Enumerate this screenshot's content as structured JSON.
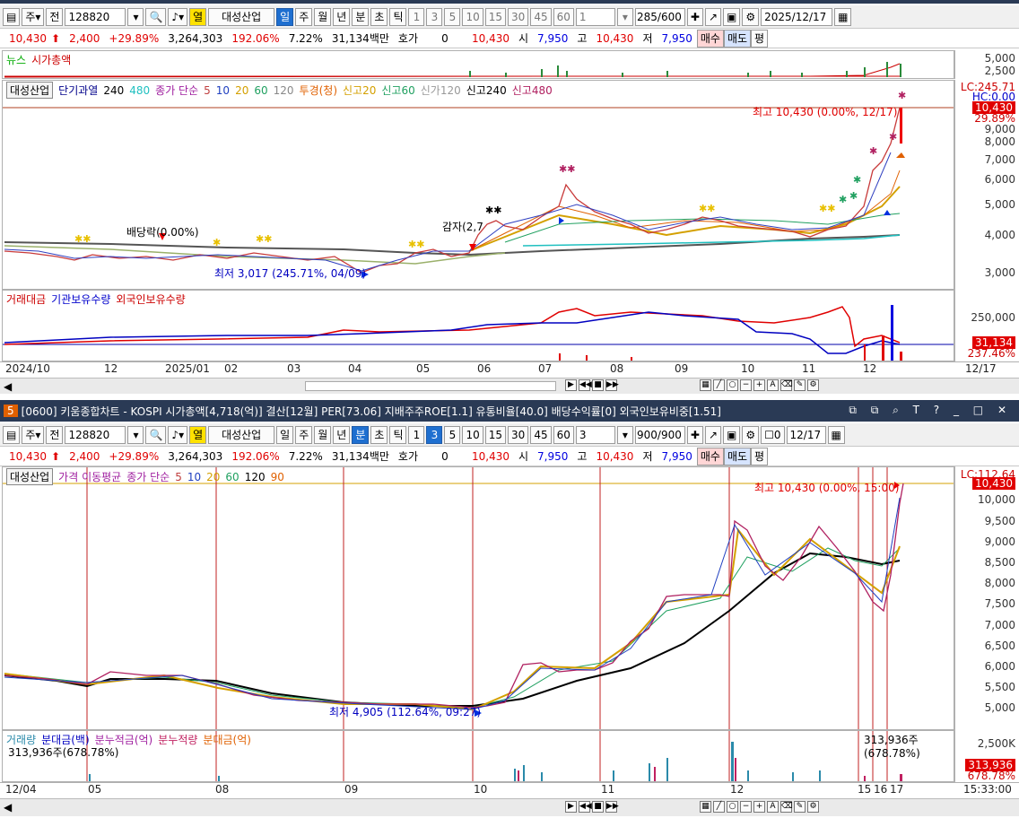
{
  "top": {
    "toolbar": {
      "mode1": "주",
      "prev": "전",
      "code": "128820",
      "hot": "열",
      "name": "대성산업",
      "periods": [
        "일",
        "주",
        "월",
        "년",
        "분",
        "초",
        "틱"
      ],
      "nums": [
        "1",
        "3",
        "5",
        "10",
        "15",
        "30",
        "45",
        "60"
      ],
      "unit": "1",
      "count": "285/600",
      "date": "2025/12/17"
    },
    "quote": {
      "price": "10,430",
      "change": "2,400",
      "rate": "+29.89%",
      "volume": "3,264,303",
      "vol_ratio": "192.06%",
      "turnover": "7.22%",
      "amount": "31,134백만",
      "ask_label": "호가",
      "ask": "0",
      "ask_price": "10,430",
      "open_label": "시",
      "open": "7,950",
      "high_label": "고",
      "high": "10,430",
      "low_label": "저",
      "low": "7,950",
      "buy": "매수",
      "sell": "매도",
      "eval": "평"
    },
    "news_legend": [
      "뉴스",
      "시가총액"
    ],
    "news_axis": [
      "5,000",
      "2,500"
    ],
    "price_legend": {
      "name": "대성산업",
      "ma_label": "단기과열",
      "n240": "240",
      "n480": "480",
      "close_label": "종가 단순",
      "p5": "5",
      "p10": "10",
      "p20": "20",
      "p60": "60",
      "p120": "120",
      "invest": "투경(청)",
      "hi20": "신고20",
      "hi60": "신고60",
      "lo120": "신가120",
      "hi240": "신고240",
      "hi480": "신고480"
    },
    "price_axis": [
      "9,000",
      "8,000",
      "7,000",
      "6,000",
      "5,000",
      "4,000",
      "3,000"
    ],
    "lc": "LC:245.71",
    "hc": "HC:0.00",
    "price_tag": "10,430",
    "price_tag2": "29.89%",
    "hi_note": "최고 10,430 (0.00%, 12/17)",
    "lo_note": "최저 3,017 (245.71%, 04/09)",
    "div_note": "배당락(0.00%)",
    "cap_note": "감자(2,7",
    "vol_legend": [
      "거래대금",
      "기관보유수량",
      "외국인보유수량"
    ],
    "vol_axis": [
      "250,000"
    ],
    "vol_tag": "31,134",
    "vol_tag2": "237.46%",
    "xaxis": [
      "2024/10",
      "12",
      "2025/01",
      "02",
      "03",
      "04",
      "05",
      "06",
      "07",
      "08",
      "09",
      "10",
      "11",
      "12",
      "12/17"
    ]
  },
  "bottom": {
    "title": "[0600] 키움종합차트 - KOSPI 시가총액[4,718(억)] 결산[12월] PER[73.06] 지배주주ROE[1.1] 유통비율[40.0] 배당수익률[0] 외국인보유비중[1.51]",
    "badge": "5",
    "toolbar": {
      "mode1": "주",
      "prev": "전",
      "code": "128820",
      "hot": "열",
      "name": "대성산업",
      "periods": [
        "일",
        "주",
        "월",
        "년",
        "분",
        "초",
        "틱"
      ],
      "nums": [
        "1",
        "3",
        "5",
        "10",
        "15",
        "30",
        "45",
        "60"
      ],
      "unit": "3",
      "count": "900/900",
      "flag": "0",
      "date": "12/17"
    },
    "quote": {
      "price": "10,430",
      "change": "2,400",
      "rate": "+29.89%",
      "volume": "3,264,303",
      "vol_ratio": "192.06%",
      "turnover": "7.22%",
      "amount": "31,134백만",
      "ask_label": "호가",
      "ask": "0",
      "ask_price": "10,430",
      "open_label": "시",
      "open": "7,950",
      "high_label": "고",
      "high": "10,430",
      "low_label": "저",
      "low": "7,950",
      "buy": "매수",
      "sell": "매도",
      "eval": "평"
    },
    "price_legend": {
      "name": "대성산업",
      "ma_label": "가격 이동평균",
      "close_label": "종가 단순",
      "p5": "5",
      "p10": "10",
      "p20": "20",
      "p60": "60",
      "p120": "120",
      "p90": "90"
    },
    "price_axis": [
      "10,000",
      "9,500",
      "9,000",
      "8,500",
      "8,000",
      "7,500",
      "7,000",
      "6,500",
      "6,000",
      "5,500",
      "5,000"
    ],
    "lc": "LC:112.64",
    "price_tag": "10,430",
    "hi_note": "최고 10,430 (0.00%, 15:00)",
    "lo_note": "최저 4,905 (112.64%, 09:27)",
    "vol_legend": [
      "거래량",
      "분대금(백)",
      "분누적금(억)",
      "분누적량",
      "분대금(억)"
    ],
    "vol_note": "313,936주(678.78%)",
    "vol_note_right": "313,936주(678.78%)",
    "vol_axis": [
      "2,500K"
    ],
    "vol_tag": "313,936",
    "vol_tag2": "678.78%",
    "xaxis": [
      "12/04",
      "05",
      "08",
      "09",
      "10",
      "11",
      "12",
      "15",
      "16",
      "17",
      "15:33:00"
    ]
  }
}
